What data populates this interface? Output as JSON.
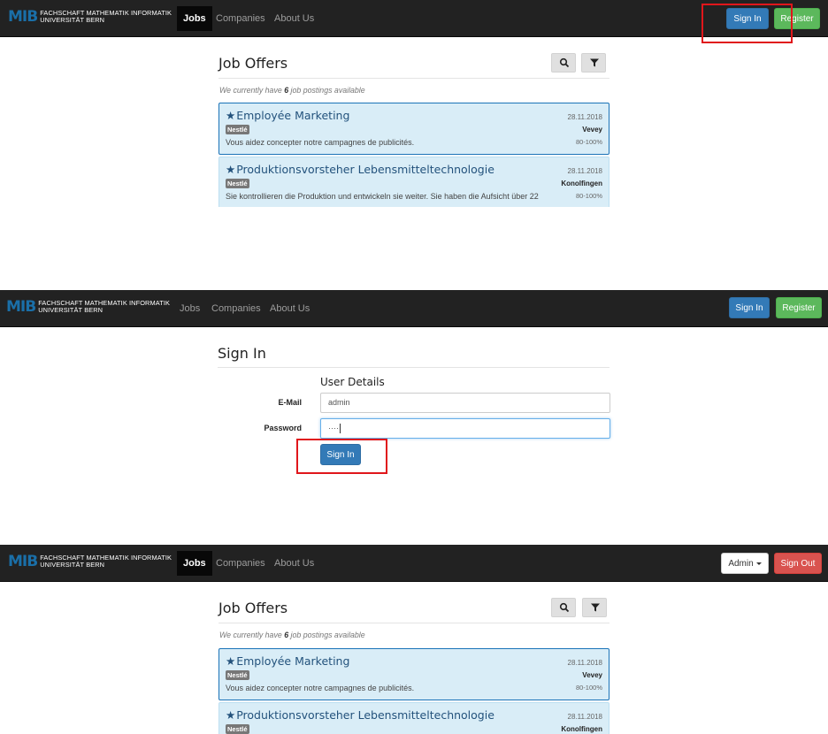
{
  "brand": {
    "mark": "MIB",
    "line1": "Fachschaft Mathematik Informatik",
    "line2": "Universität Bern"
  },
  "nav": {
    "jobs": "Jobs",
    "companies": "Companies",
    "about": "About Us"
  },
  "auth": {
    "sign_in": "Sign In",
    "register": "Register",
    "user_menu": "Admin",
    "sign_out": "Sign Out"
  },
  "jobs_page": {
    "title": "Job Offers",
    "note_prefix": "We currently have ",
    "count": "6",
    "note_suffix": " job postings available",
    "offers": [
      {
        "title": "Employée Marketing",
        "company": "Nestlé",
        "description": "Vous aidez concepter notre campagnes de publicités.",
        "date": "28.11.2018",
        "location": "Vevey",
        "workload": "80-100%"
      },
      {
        "title": "Produktionsvorsteher Lebensmitteltechnologie",
        "company": "Nestlé",
        "description": "Sie kontrollieren die Produktion und entwickeln sie weiter. Sie haben die Aufsicht über 22",
        "date": "28.11.2018",
        "location": "Konolfingen",
        "workload": "80-100%"
      }
    ]
  },
  "signin_page": {
    "title": "Sign In",
    "section": "User Details",
    "email_label": "E-Mail",
    "email_value": "admin",
    "password_label": "Password",
    "password_value": "····",
    "submit": "Sign In"
  },
  "icons": {
    "search": "search-icon",
    "filter": "filter-icon",
    "star": "star-icon",
    "caret": "caret-down-icon"
  },
  "colors": {
    "navbar": "#222222",
    "primary": "#337ab7",
    "success": "#5cb85c",
    "danger": "#d9534f",
    "card": "#d9edf7",
    "highlight": "#e0161b"
  }
}
